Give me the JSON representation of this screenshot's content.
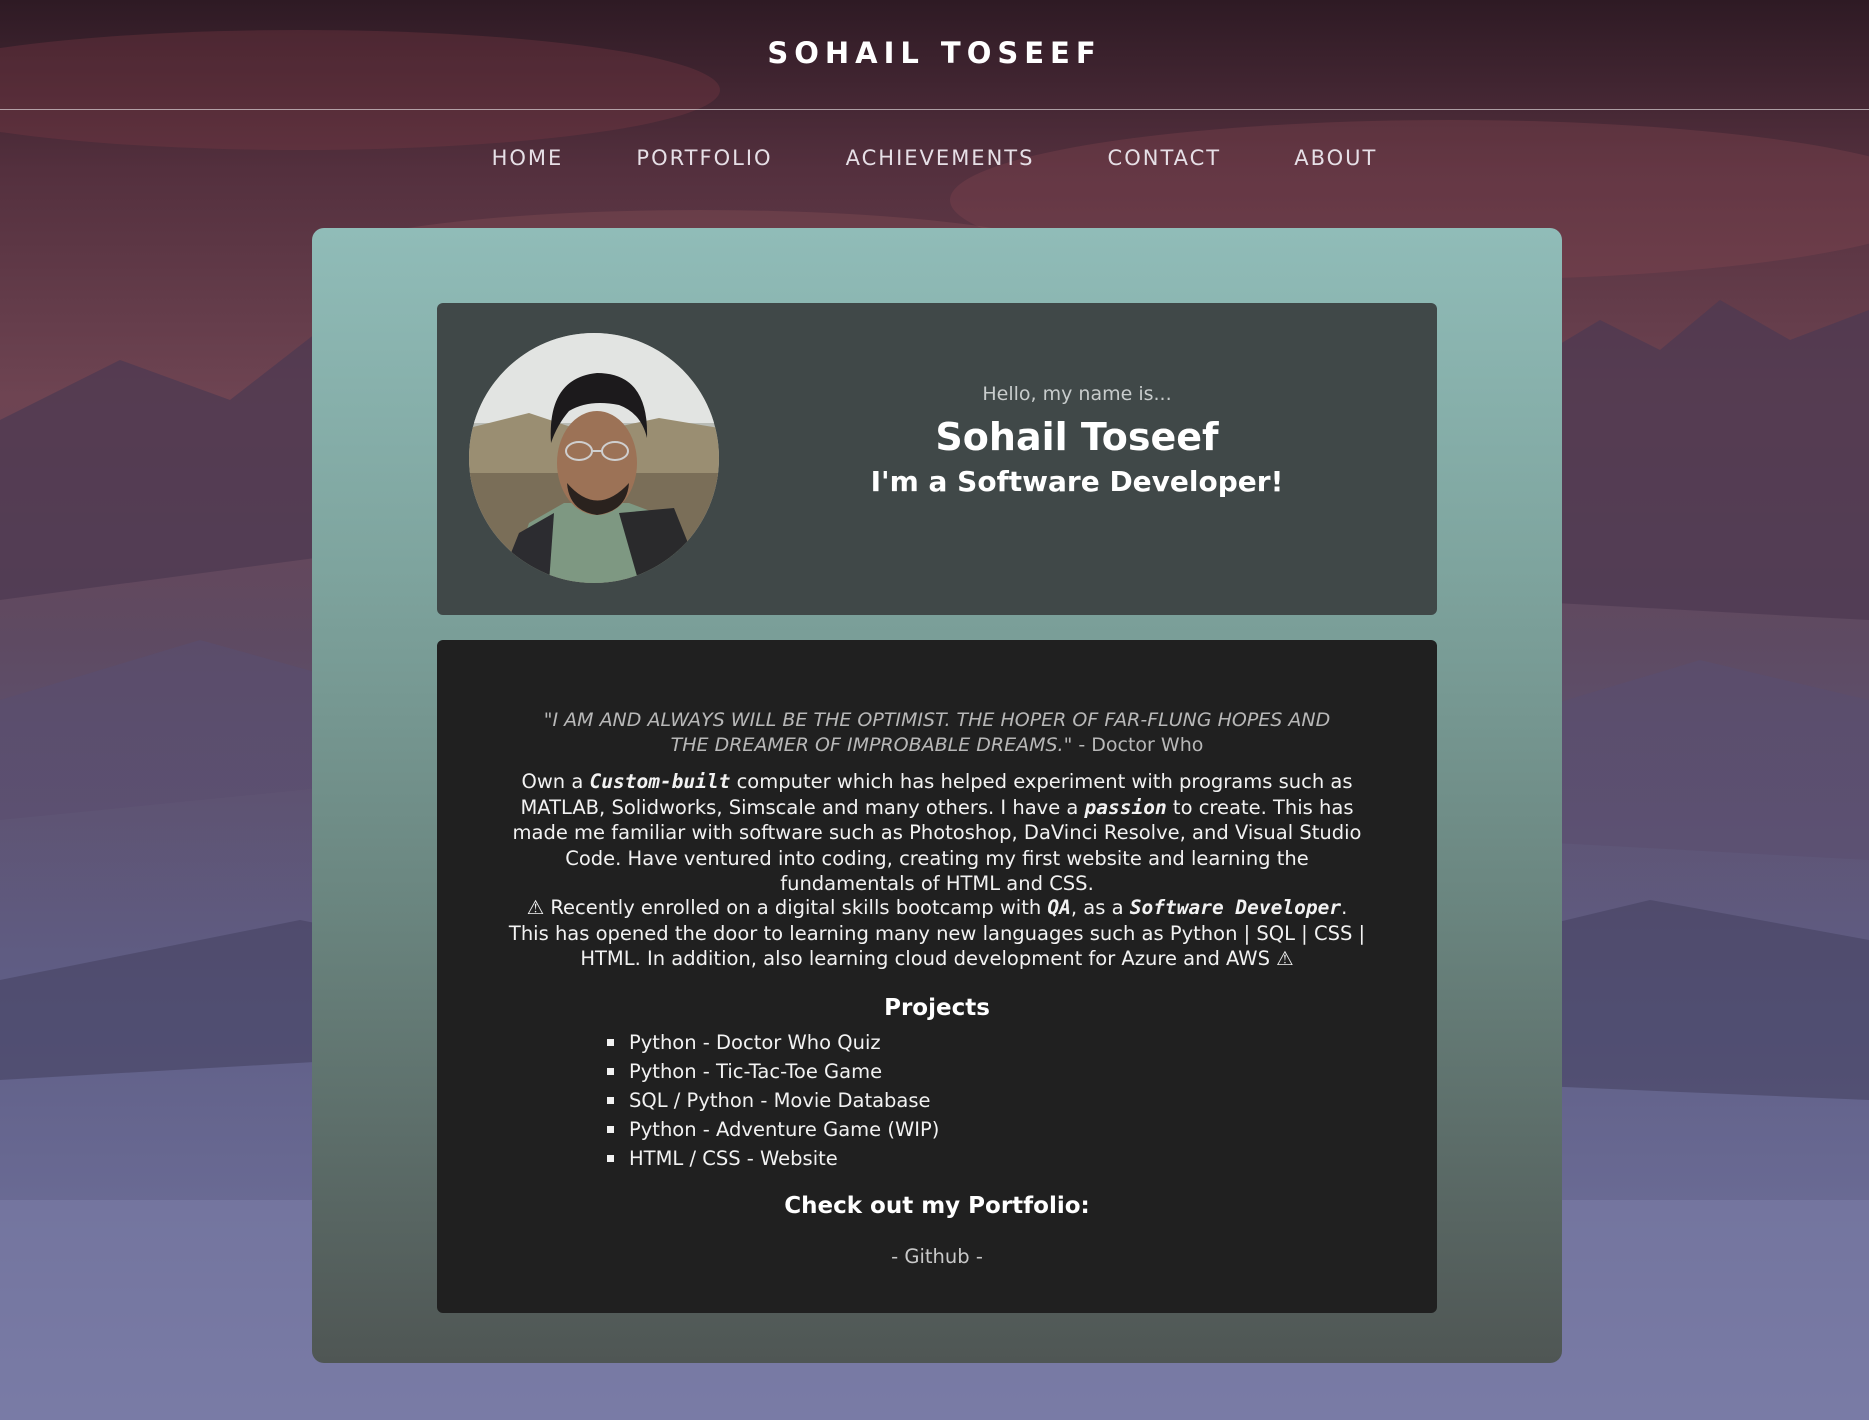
{
  "header": {
    "site_title": "SOHAIL TOSEEF"
  },
  "nav": {
    "items": [
      {
        "label": "HOME"
      },
      {
        "label": "PORTFOLIO"
      },
      {
        "label": "ACHIEVEMENTS"
      },
      {
        "label": "CONTACT"
      },
      {
        "label": "ABOUT"
      }
    ]
  },
  "intro": {
    "greeting": "Hello, my name is...",
    "name": "Sohail Toseef",
    "role": "I'm a Software Developer!",
    "avatar_icon": "profile-photo"
  },
  "about": {
    "quote_text": "\"I am and always will be the optimist. The hoper of far-flung hopes and the dreamer of improbable dreams.\"",
    "quote_author": " - Doctor Who",
    "para1": {
      "t1": "Own a ",
      "e1": "Custom-built",
      "t2": " computer which has helped experiment with programs such as MATLAB, Solidworks, Simscale and many others. I have a ",
      "e2": "passion",
      "t3": " to create. This has made me familiar with software such as Photoshop, DaVinci Resolve, and Visual Studio Code. Have ventured into coding, creating my first website and learning the fundamentals of HTML and CSS."
    },
    "para2": {
      "warn_icon": "⚠",
      "t1": " Recently enrolled on a digital skills bootcamp with ",
      "e1": "QA",
      "t2": ", as a ",
      "e2": "Software Developer",
      "t3": ". This has opened the door to learning many new languages such as Python | SQL | CSS | HTML. In addition, also learning cloud development for Azure and AWS ",
      "warn_icon_end": "⚠"
    },
    "projects_title": "Projects",
    "projects": [
      "Python - Doctor Who Quiz",
      "Python - Tic-Tac-Toe Game",
      "SQL / Python - Movie Database",
      "Python - Adventure Game (WIP)",
      "HTML / CSS - Website"
    ],
    "portfolio_title": "Check out my Portfolio:",
    "github_label": "- Github -"
  },
  "colors": {
    "card_top": "#90bcb8",
    "card_bottom": "#4f5654",
    "intro_box": "#404848",
    "about_box": "#202020"
  }
}
